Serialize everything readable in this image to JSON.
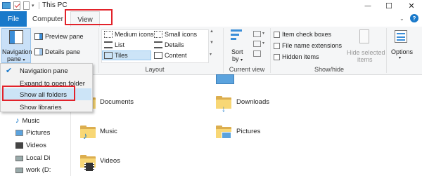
{
  "window": {
    "title": "This PC",
    "minimize": "—",
    "maximize": "☐",
    "close": "✕"
  },
  "tabs": {
    "file": "File",
    "computer": "Computer",
    "view": "View"
  },
  "ribbon": {
    "pane_group": {
      "navigation_pane": "Navigation",
      "navigation_pane2": "pane",
      "preview_pane": "Preview pane",
      "details_pane": "Details pane"
    },
    "layout_group": {
      "medium_icons": "Medium icons",
      "small_icons": "Small icons",
      "list": "List",
      "details": "Details",
      "tiles": "Tiles",
      "content": "Content",
      "label": "Layout"
    },
    "current_view": {
      "sort_by": "Sort",
      "sort_by2": "by",
      "label": "Current view"
    },
    "show_hide": {
      "item_check_boxes": "Item check boxes",
      "file_name_extensions": "File name extensions",
      "hidden_items": "Hidden items",
      "hide_selected": "Hide selected",
      "hide_selected2": "items",
      "label": "Show/hide"
    },
    "options": "Options"
  },
  "nav_menu": {
    "items": [
      "Navigation pane",
      "Expand to open folder",
      "Show all folders",
      "Show libraries"
    ]
  },
  "sidebar": {
    "items": [
      "Music",
      "Pictures",
      "Videos",
      "Local Di",
      "work (D:"
    ]
  },
  "folders": [
    "Documents",
    "Downloads",
    "Music",
    "Pictures",
    "Videos"
  ],
  "colors": {
    "accent": "#1979ca",
    "highlight": "#e2222a",
    "folder": "#f8d775"
  }
}
